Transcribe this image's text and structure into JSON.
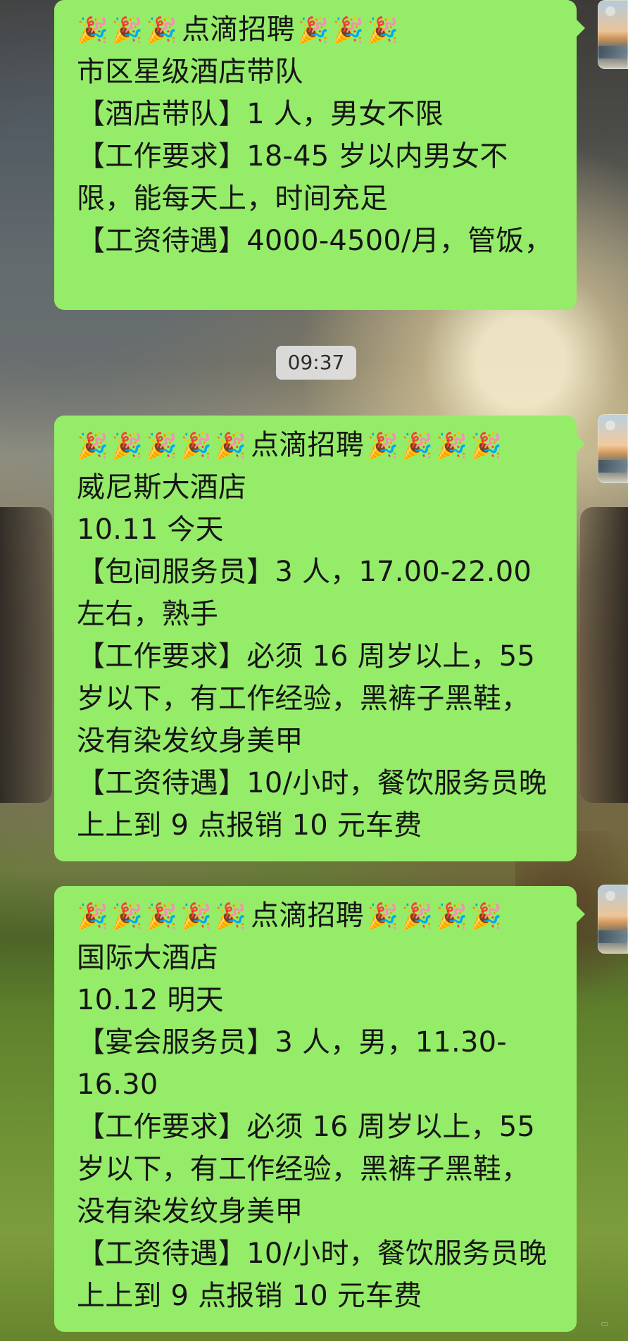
{
  "messages": [
    {
      "title": "点滴招聘",
      "lines": [
        "市区星级酒店带队",
        "【酒店带队】1 人，男女不限",
        "【工作要求】18-45 岁以内男女不限，能每天上，时间充足",
        "【工资待遇】4000-4500/月，管饭，"
      ]
    },
    {
      "title": "点滴招聘",
      "lines": [
        "威尼斯大酒店",
        "10.11 今天",
        "【包间服务员】3 人，17.00-22.00 左右，熟手",
        "【工作要求】必须 16 周岁以上，55 岁以下，有工作经验，黑裤子黑鞋，没有染发纹身美甲",
        "【工资待遇】10/小时，餐饮服务员晚上上到 9 点报销 10 元车费"
      ]
    },
    {
      "title": "点滴招聘",
      "lines": [
        "国际大酒店",
        "10.12 明天",
        "【宴会服务员】3 人，男，11.30-16.30",
        "【工作要求】必须 16 周岁以上，55 岁以下，有工作经验，黑裤子黑鞋，没有染发纹身美甲",
        "【工资待遇】10/小时，餐饮服务员晚上上到 9 点报销 10 元车费"
      ]
    }
  ],
  "timestamp": "09:37",
  "icons": {
    "party_popper": "🎉",
    "avatar": "avatar-icon"
  }
}
